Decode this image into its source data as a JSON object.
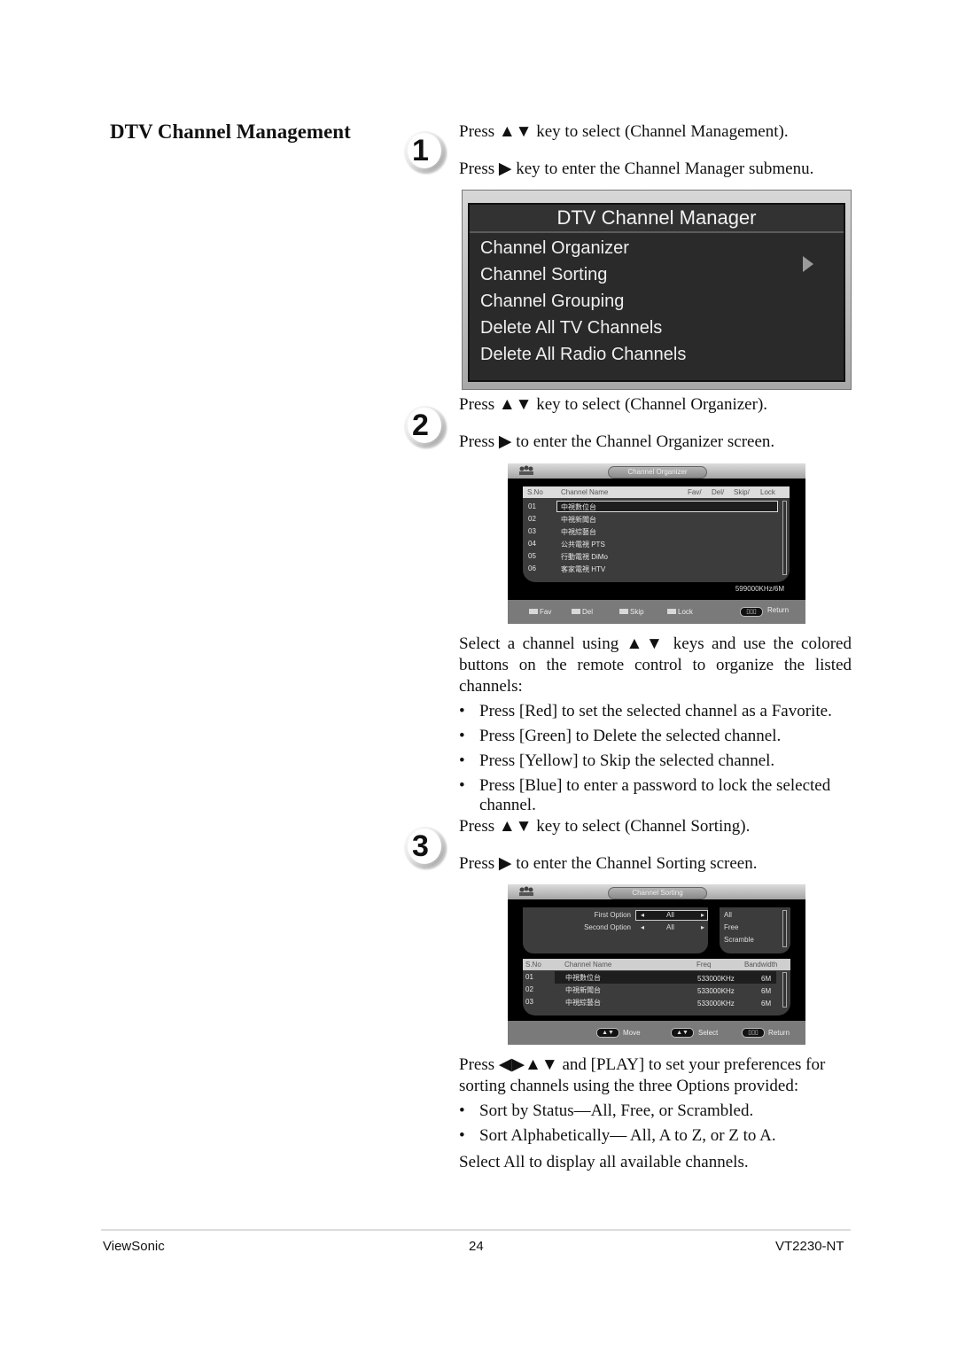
{
  "section_title": "DTV Channel Management",
  "steps": [
    {
      "number": "1",
      "lines": [
        "Press ▲▼ key to select (Channel Management).",
        "Press ▶ key to enter the Channel Manager submenu."
      ]
    },
    {
      "number": "2",
      "lines": [
        "Press ▲▼ key to select (Channel Organizer).",
        "Press ▶ to enter the Channel Organizer screen."
      ]
    },
    {
      "number": "3",
      "lines": [
        "Press ▲▼ key to select (Channel Sorting).",
        "Press ▶ to enter the Channel Sorting screen."
      ]
    }
  ],
  "channel_manager_menu": {
    "title": "DTV Channel Manager",
    "items": [
      "Channel Organizer",
      "Channel Sorting",
      "Channel Grouping",
      "Delete All TV Channels",
      "Delete All Radio Channels"
    ],
    "selected_index": 0
  },
  "channel_organizer_screen": {
    "title": "Channel Organizer",
    "columns": [
      "S.No",
      "Channel Name",
      "Fav/",
      "Del/",
      "Skip/",
      "Lock"
    ],
    "rows": [
      {
        "no": "01",
        "name": "中視數位台"
      },
      {
        "no": "02",
        "name": "中視新聞台"
      },
      {
        "no": "03",
        "name": "中視綜藝台"
      },
      {
        "no": "04",
        "name": "公共電視 PTS"
      },
      {
        "no": "05",
        "name": "行動電視 DiMo"
      },
      {
        "no": "06",
        "name": "客家電視 HTV"
      }
    ],
    "selected_index": 0,
    "frequency": "599000KHz/6M",
    "footer": {
      "fav": "Fav",
      "del": "Del",
      "skip": "Skip",
      "lock": "Lock",
      "return_key": "▯▯▯",
      "return": "Return"
    }
  },
  "organizer_text": {
    "intro": "Select a channel using ▲▼ keys and use the colored buttons on the remote control to organize the listed channels:",
    "bullets": [
      "Press [Red] to set the selected channel as a Favorite.",
      "Press [Green] to Delete the selected channel.",
      "Press [Yellow] to Skip the selected channel.",
      "Press [Blue] to enter a password to lock the selected channel."
    ]
  },
  "channel_sorting_screen": {
    "title": "Channel Sorting",
    "first_option_label": "First Option",
    "first_option_value": "All",
    "second_option_label": "Second Option",
    "second_option_value": "All",
    "option_list": [
      "All",
      "Free",
      "Scramble"
    ],
    "columns": [
      "S.No",
      "Channel Name",
      "Freq",
      "Bandwidth"
    ],
    "rows": [
      {
        "no": "01",
        "name": "中視數位台",
        "freq": "533000KHz",
        "bw": "6M"
      },
      {
        "no": "02",
        "name": "中視新聞台",
        "freq": "533000KHz",
        "bw": "6M"
      },
      {
        "no": "03",
        "name": "中視綜藝台",
        "freq": "533000KHz",
        "bw": "6M"
      }
    ],
    "footer": {
      "move_key": "▲▼",
      "move": "Move",
      "select_key": "▲▼",
      "select": "Select",
      "return_key": "▯▯▯",
      "return": "Return"
    }
  },
  "sorting_text": {
    "intro": "Press ◀▶▲▼ and [PLAY] to set your preferences for sorting channels using the three Options provided:",
    "bullets": [
      "Sort by Status—All, Free, or Scrambled.",
      "Sort Alphabetically— All, A to Z, or Z to A."
    ],
    "outro": "Select All to display all available channels."
  },
  "page_footer": {
    "brand": "ViewSonic",
    "page_number": "24",
    "model": "VT2230-NT"
  }
}
